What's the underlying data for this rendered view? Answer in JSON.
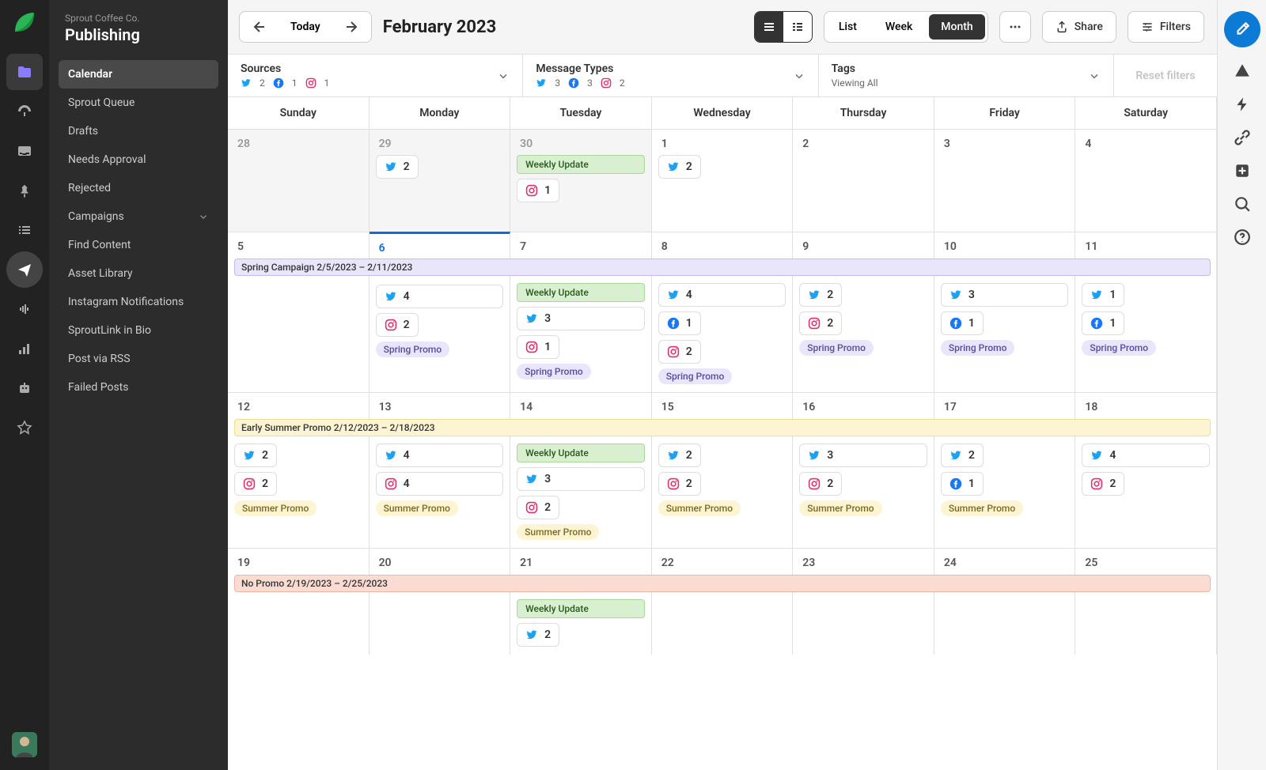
{
  "company": "Sprout Coffee Co.",
  "section": "Publishing",
  "sidebar": {
    "items": [
      "Calendar",
      "Sprout Queue",
      "Drafts",
      "Needs Approval",
      "Rejected",
      "Campaigns",
      "Find Content",
      "Asset Library",
      "Instagram Notifications",
      "SproutLink in Bio",
      "Post via RSS",
      "Failed Posts"
    ]
  },
  "topbar": {
    "today": "Today",
    "title": "February 2023",
    "views": {
      "list": "List",
      "week": "Week",
      "month": "Month"
    },
    "share": "Share",
    "filters": "Filters"
  },
  "filters": {
    "sources": {
      "label": "Sources",
      "tw": "2",
      "fb": "1",
      "ig": "1"
    },
    "types": {
      "label": "Message Types",
      "tw": "3",
      "fb": "3",
      "ig": "2"
    },
    "tags": {
      "label": "Tags",
      "sub": "Viewing All"
    },
    "reset": "Reset filters"
  },
  "days": [
    "Sunday",
    "Monday",
    "Tuesday",
    "Wednesday",
    "Thursday",
    "Friday",
    "Saturday"
  ],
  "labels": {
    "weekly_update": "Weekly Update",
    "spring_promo": "Spring Promo",
    "summer_promo": "Summer Promo"
  },
  "spans": {
    "spring": "Spring Campaign 2/5/2023 – 2/11/2023",
    "early": "Early Summer Promo 2/12/2023 – 2/18/2023",
    "nopromo": "No Promo 2/19/2023 – 2/25/2023"
  },
  "weeks": [
    {
      "days": [
        {
          "n": "28",
          "muted": true
        },
        {
          "n": "29",
          "muted": true,
          "pills": [
            {
              "t": "tw",
              "c": "2"
            }
          ]
        },
        {
          "n": "30",
          "muted": true,
          "green": true,
          "pills": [
            {
              "t": "ig",
              "c": "1"
            }
          ]
        },
        {
          "n": "1",
          "pills": [
            {
              "t": "tw",
              "c": "2"
            }
          ]
        },
        {
          "n": "2"
        },
        {
          "n": "3"
        },
        {
          "n": "4"
        }
      ]
    },
    {
      "span": "spring",
      "span_class": "span-purple",
      "today_col": 1,
      "days": [
        {
          "n": "5"
        },
        {
          "n": "6",
          "today": true,
          "pills": [
            {
              "t": "tw",
              "c": "4",
              "full": true
            },
            {
              "t": "ig",
              "c": "2"
            }
          ],
          "tag": "purple"
        },
        {
          "n": "7",
          "green": true,
          "pills": [
            {
              "t": "tw",
              "c": "3",
              "full": true
            },
            {
              "t": "ig",
              "c": "1"
            }
          ],
          "tag": "purple"
        },
        {
          "n": "8",
          "pills": [
            {
              "t": "tw",
              "c": "4",
              "full": true
            },
            {
              "t": "fb",
              "c": "1"
            },
            {
              "t": "ig",
              "c": "2"
            }
          ],
          "tag": "purple"
        },
        {
          "n": "9",
          "pills": [
            {
              "t": "tw",
              "c": "2"
            },
            {
              "t": "ig",
              "c": "2"
            }
          ],
          "tag": "purple"
        },
        {
          "n": "10",
          "pills": [
            {
              "t": "tw",
              "c": "3",
              "full": true
            },
            {
              "t": "fb",
              "c": "1"
            }
          ],
          "tag": "purple"
        },
        {
          "n": "11",
          "pills": [
            {
              "t": "tw",
              "c": "1"
            },
            {
              "t": "fb",
              "c": "1"
            }
          ],
          "tag": "purple"
        }
      ]
    },
    {
      "span": "early",
      "span_class": "span-yellow",
      "days": [
        {
          "n": "12",
          "pills": [
            {
              "t": "tw",
              "c": "2"
            },
            {
              "t": "ig",
              "c": "2"
            }
          ],
          "tag": "yellow"
        },
        {
          "n": "13",
          "pills": [
            {
              "t": "tw",
              "c": "4",
              "full": true
            },
            {
              "t": "ig",
              "c": "4",
              "full": true
            }
          ],
          "tag": "yellow"
        },
        {
          "n": "14",
          "green": true,
          "pills": [
            {
              "t": "tw",
              "c": "3",
              "full": true
            },
            {
              "t": "ig",
              "c": "2"
            }
          ],
          "tag": "yellow"
        },
        {
          "n": "15",
          "pills": [
            {
              "t": "tw",
              "c": "2"
            },
            {
              "t": "ig",
              "c": "2"
            }
          ],
          "tag": "yellow"
        },
        {
          "n": "16",
          "pills": [
            {
              "t": "tw",
              "c": "3",
              "full": true
            },
            {
              "t": "ig",
              "c": "2"
            }
          ],
          "tag": "yellow"
        },
        {
          "n": "17",
          "pills": [
            {
              "t": "tw",
              "c": "2"
            },
            {
              "t": "fb",
              "c": "1"
            }
          ],
          "tag": "yellow"
        },
        {
          "n": "18",
          "pills": [
            {
              "t": "tw",
              "c": "4",
              "full": true
            },
            {
              "t": "ig",
              "c": "2"
            }
          ]
        }
      ]
    },
    {
      "span": "nopromo",
      "span_class": "span-salmon",
      "days": [
        {
          "n": "19"
        },
        {
          "n": "20"
        },
        {
          "n": "21",
          "green": true,
          "pills": [
            {
              "t": "tw",
              "c": "2"
            }
          ]
        },
        {
          "n": "22"
        },
        {
          "n": "23"
        },
        {
          "n": "24"
        },
        {
          "n": "25"
        }
      ]
    }
  ]
}
